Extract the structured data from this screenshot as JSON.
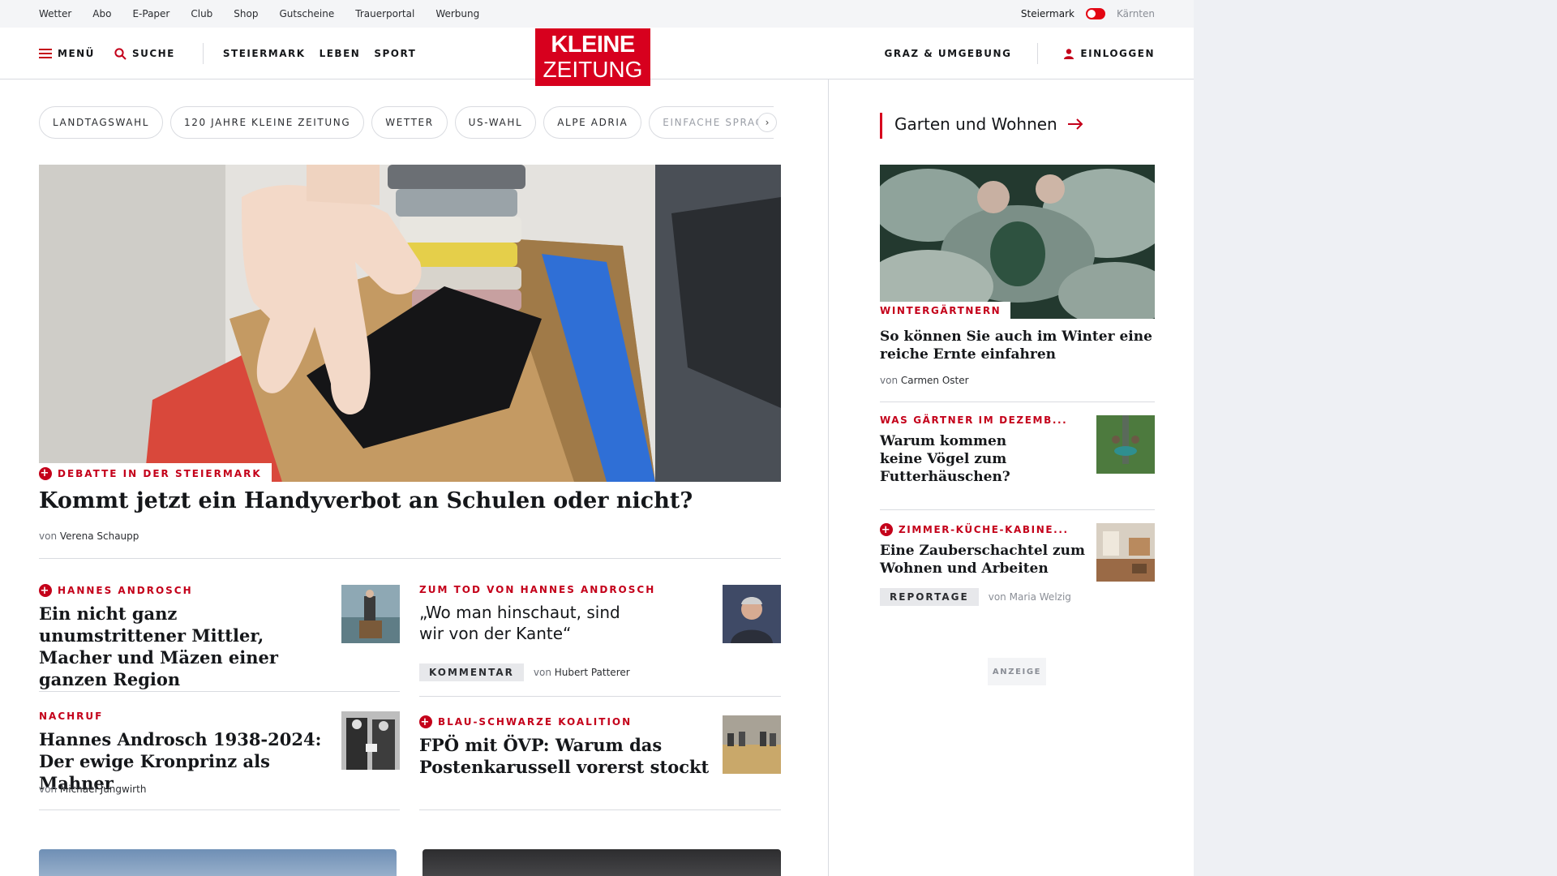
{
  "topbar": {
    "links": [
      "Wetter",
      "Abo",
      "E-Paper",
      "Club",
      "Shop",
      "Gutscheine",
      "Trauerportal",
      "Werbung"
    ],
    "region_active": "Steiermark",
    "region_inactive": "Kärnten"
  },
  "header": {
    "menu_label": "MENÜ",
    "search_label": "SUCHE",
    "nav": [
      "STEIERMARK",
      "LEBEN",
      "SPORT"
    ],
    "logo_line1": "KLEINE",
    "logo_line2": "ZEITUNG",
    "location": "GRAZ & UMGEBUNG",
    "login": "EINLOGGEN"
  },
  "pills": [
    "LANDTAGSWAHL",
    "120 JAHRE KLEINE ZEITUNG",
    "WETTER",
    "US-WAHL",
    "ALPE ADRIA",
    "EINFACHE SPRACHE"
  ],
  "hero": {
    "kicker": "DEBATTE IN DER STEIERMARK",
    "title": "Kommt jetzt ein Handyverbot an Schulen oder nicht?",
    "by_prefix": "von",
    "author": "Verena Schaupp"
  },
  "articles": [
    {
      "kicker": "HANNES ANDROSCH",
      "title": "Ein nicht ganz unumstrittener Mittler, Macher und Mäzen einer ganzen Region"
    },
    {
      "kicker": "ZUM TOD VON HANNES ANDROSCH",
      "quote": "„Wo man hinschaut, sind wir von der Kante“",
      "tag": "KOMMENTAR",
      "by_prefix": "von",
      "author": "Hubert Patterer"
    },
    {
      "kicker": "NACHRUF",
      "title": "Hannes Androsch 1938-2024: Der ewige Kronprinz als Mahner",
      "by_prefix": "von",
      "author": "Michael Jungwirth"
    },
    {
      "kicker": "BLAU-SCHWARZE KOALITION",
      "title": "FPÖ mit ÖVP: Warum das Postenkarussell vorerst stockt"
    }
  ],
  "sidebar": {
    "section_title": "Garten und Wohnen",
    "lead": {
      "kicker": "WINTERGÄRTNERN",
      "title": "So können Sie auch im Winter eine reiche Ernte einfahren",
      "by_prefix": "von",
      "author": "Carmen Oster"
    },
    "items": [
      {
        "kicker": "WAS GÄRTNER IM DEZEMB...",
        "title": "Warum kommen keine Vögel zum Futterhäuschen?"
      },
      {
        "kicker": "ZIMMER-KÜCHE-KABINE...",
        "title": "Eine Zauberschachtel zum Wohnen und Arbeiten",
        "tag": "REPORTAGE",
        "by_prefix": "von",
        "author": "Maria Welzig"
      }
    ],
    "ad_label": "ANZEIGE"
  },
  "colors": {
    "brand_red": "#d7001e",
    "kicker_red": "#c4001a"
  }
}
